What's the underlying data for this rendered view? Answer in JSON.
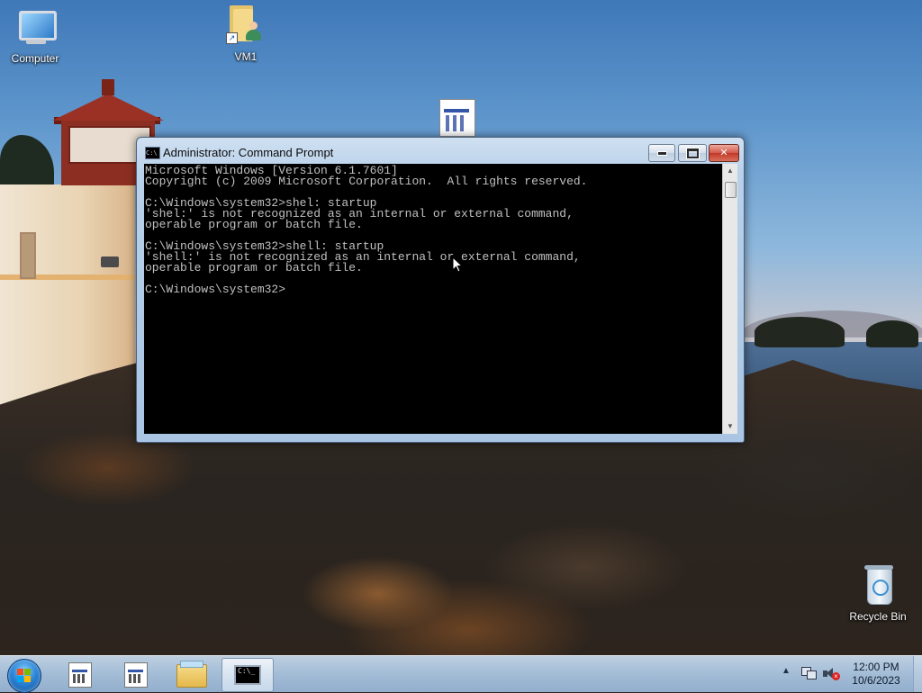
{
  "desktop": {
    "icons": [
      {
        "label": "Computer",
        "icon": "computer-icon"
      },
      {
        "label": "VM1",
        "icon": "user-folder-shortcut-icon"
      },
      {
        "label": "Recycle Bin",
        "icon": "recycle-bin-icon"
      }
    ],
    "unlabeled_icon": "document-file-icon"
  },
  "cmd_window": {
    "title": "Administrator: Command Prompt",
    "controls": {
      "minimize": "minimize-icon",
      "maximize": "maximize-icon",
      "close": "✕"
    },
    "lines": [
      "Microsoft Windows [Version 6.1.7601]",
      "Copyright (c) 2009 Microsoft Corporation.  All rights reserved.",
      "",
      "C:\\Windows\\system32>shel: startup",
      "'shel:' is not recognized as an internal or external command,",
      "operable program or batch file.",
      "",
      "C:\\Windows\\system32>shell: startup",
      "'shell:' is not recognized as an internal or external command,",
      "operable program or batch file.",
      "",
      "C:\\Windows\\system32>"
    ]
  },
  "taskbar": {
    "start_icon": "windows-start-orb-icon",
    "buttons": [
      {
        "icon": "document-file-icon",
        "active": false
      },
      {
        "icon": "document-file-icon",
        "active": false
      },
      {
        "icon": "windows-explorer-folder-icon",
        "active": false
      },
      {
        "icon": "command-prompt-icon",
        "active": true
      }
    ],
    "tray": {
      "icons": [
        "show-hidden-icons-arrow",
        "network-icon",
        "volume-muted-icon"
      ],
      "time": "12:00 PM",
      "date": "10/6/2023"
    }
  },
  "colors": {
    "console_bg": "#000000",
    "console_text": "#c0c0c0",
    "close_button": "#c13826"
  }
}
